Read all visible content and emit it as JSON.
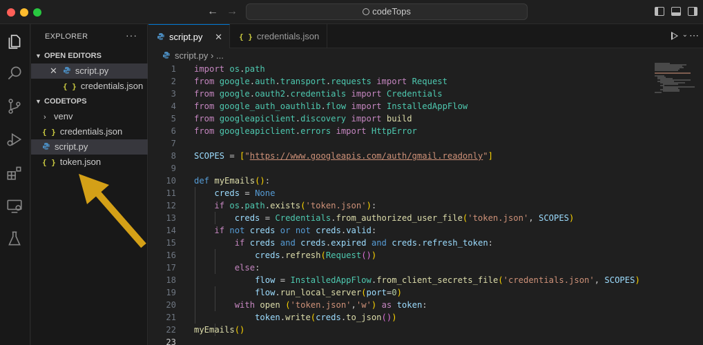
{
  "window": {
    "title": "codeTops"
  },
  "activity": [
    "explorer-icon",
    "search-icon",
    "source-control-icon",
    "run-debug-icon",
    "extensions-icon",
    "remote-explorer-icon",
    "testing-icon"
  ],
  "sidebar": {
    "title": "EXPLORER",
    "more": "···",
    "open_editors": {
      "label": "OPEN EDITORS",
      "items": [
        {
          "close": "✕",
          "name": "script.py",
          "type": "python"
        },
        {
          "name": "credentials.json",
          "type": "json"
        }
      ]
    },
    "folder": {
      "label": "CODETOPS",
      "items": [
        {
          "name": "venv",
          "type": "folder"
        },
        {
          "name": "credentials.json",
          "type": "json"
        },
        {
          "name": "script.py",
          "type": "python"
        },
        {
          "name": "token.json",
          "type": "json"
        }
      ]
    },
    "json_glyph": "{ }"
  },
  "tabs": [
    {
      "label": "script.py",
      "close": "✕",
      "active": true
    },
    {
      "label": "credentials.json",
      "active": false
    }
  ],
  "breadcrumb": {
    "file": "script.py",
    "separator": "›",
    "rest": "..."
  },
  "editor": {
    "line_numbers": [
      "1",
      "2",
      "3",
      "4",
      "5",
      "6",
      "7",
      "8",
      "9",
      "10",
      "11",
      "12",
      "13",
      "14",
      "15",
      "16",
      "17",
      "18",
      "19",
      "20",
      "21",
      "22",
      "23"
    ],
    "current_line": "23"
  },
  "annotation": {
    "arrow_color": "#d4a017"
  },
  "colors": {
    "accent": "#0078d4",
    "json": "#cbcb41",
    "python": "#4b8bbe"
  }
}
